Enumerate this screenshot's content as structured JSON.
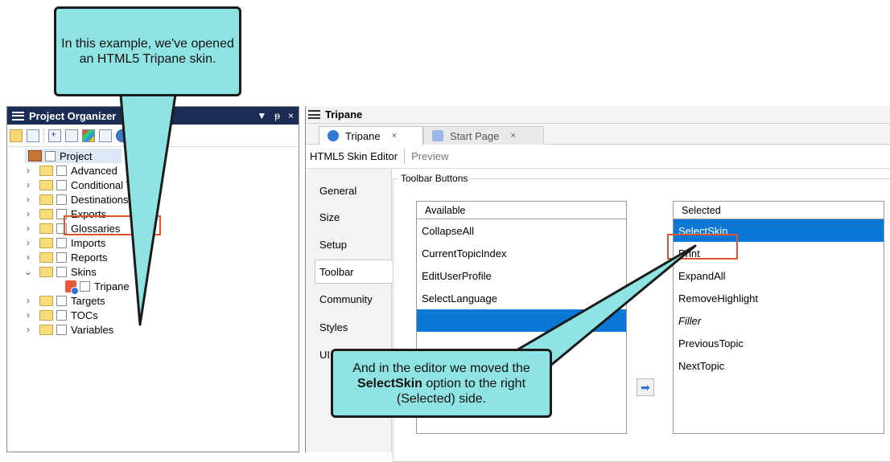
{
  "project_panel": {
    "title": "Project Organizer",
    "title_controls": [
      "▼",
      "ᵽ",
      "×"
    ],
    "root_label": "Project",
    "items": [
      {
        "label": "Advanced",
        "expanded": false
      },
      {
        "label": "Conditional Text",
        "expanded": false
      },
      {
        "label": "Destinations",
        "expanded": false
      },
      {
        "label": "Exports",
        "expanded": false
      },
      {
        "label": "Glossaries",
        "expanded": false
      },
      {
        "label": "Imports",
        "expanded": false
      },
      {
        "label": "Reports",
        "expanded": false
      },
      {
        "label": "Skins",
        "expanded": true
      },
      {
        "label": "Tripane",
        "child": true
      },
      {
        "label": "Targets",
        "expanded": false
      },
      {
        "label": "TOCs",
        "expanded": false
      },
      {
        "label": "Variables",
        "expanded": false
      }
    ]
  },
  "document_panel": {
    "title": "Tripane",
    "tabs": [
      {
        "label": "Tripane",
        "close": "×",
        "active": true
      },
      {
        "label": "Start Page",
        "close": "×",
        "active": false
      }
    ],
    "editor_label": "HTML5 Skin Editor",
    "preview_label": "Preview",
    "side_tabs": [
      "General",
      "Size",
      "Setup",
      "Toolbar",
      "Community",
      "Styles",
      "UI"
    ],
    "active_side_tab": "Toolbar",
    "group_label": "Toolbar Buttons",
    "available_header": "Available",
    "available_items": [
      "CollapseAll",
      "CurrentTopicIndex",
      "EditUserProfile",
      "SelectLanguage",
      ""
    ],
    "selected_header": "Selected",
    "selected_items": [
      "SelectSkin",
      "Print",
      "ExpandAll",
      "RemoveHighlight",
      "Filler",
      "PreviousTopic",
      "NextTopic"
    ],
    "move_button_icon": "arrow-right-icon"
  },
  "callouts": {
    "top": "In this example, we've opened an HTML5 Tripane skin.",
    "bottom_prefix": "And in the editor we moved the",
    "bottom_bold": "SelectSkin",
    "bottom_suffix": "option to the right (Selected) side."
  },
  "colors": {
    "panel_title_bg": "#1b2c55",
    "selection": "#0a78d7",
    "callout_fill": "#8fe3e3",
    "highlight_box": "#e0532f"
  }
}
